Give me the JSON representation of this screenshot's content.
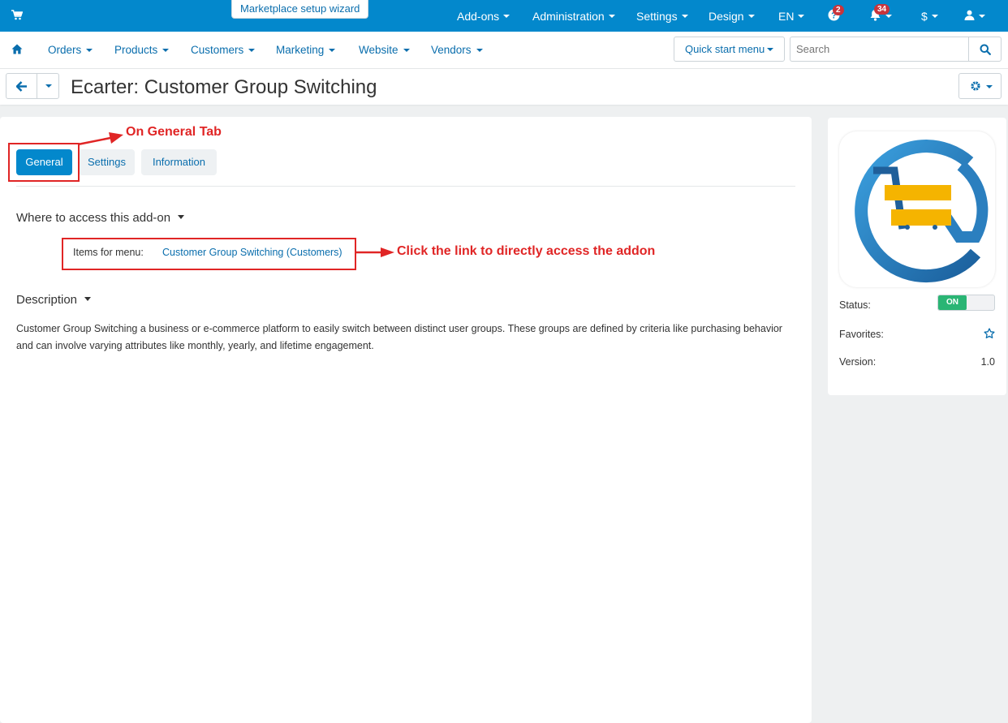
{
  "topbar": {
    "wizard_label": "Marketplace setup wizard",
    "menu": [
      "Add-ons",
      "Administration",
      "Settings",
      "Design",
      "EN"
    ],
    "help_badge": "2",
    "notif_badge": "34",
    "currency": "$"
  },
  "nav": {
    "items": [
      "Orders",
      "Products",
      "Customers",
      "Marketing",
      "Website",
      "Vendors"
    ],
    "quick_start": "Quick start menu",
    "search_placeholder": "Search"
  },
  "page": {
    "title": "Ecarter: Customer Group Switching"
  },
  "tabs": [
    "General",
    "Settings",
    "Information"
  ],
  "active_tab": "General",
  "access": {
    "heading": "Where to access this add-on",
    "items_label": "Items for menu:",
    "link_text": "Customer Group Switching (Customers)"
  },
  "description": {
    "heading": "Description",
    "text": "Customer Group Switching a business or e-commerce platform to easily switch between distinct user groups. These groups are defined by criteria like purchasing behavior and can involve varying attributes like monthly, yearly, and lifetime engagement."
  },
  "annotations": {
    "general_tab": "On General Tab",
    "link_hint": "Click the link to directly access the addon"
  },
  "side": {
    "status_label": "Status:",
    "status_value": "ON",
    "favorites_label": "Favorites:",
    "version_label": "Version:",
    "version_value": "1.0"
  },
  "colors": {
    "primary": "#0388cc",
    "link": "#0a6ead",
    "annotation": "#e02525",
    "toggle_on": "#2ab574",
    "logo_blue": "#1f74b5",
    "logo_yellow": "#f5b400"
  }
}
